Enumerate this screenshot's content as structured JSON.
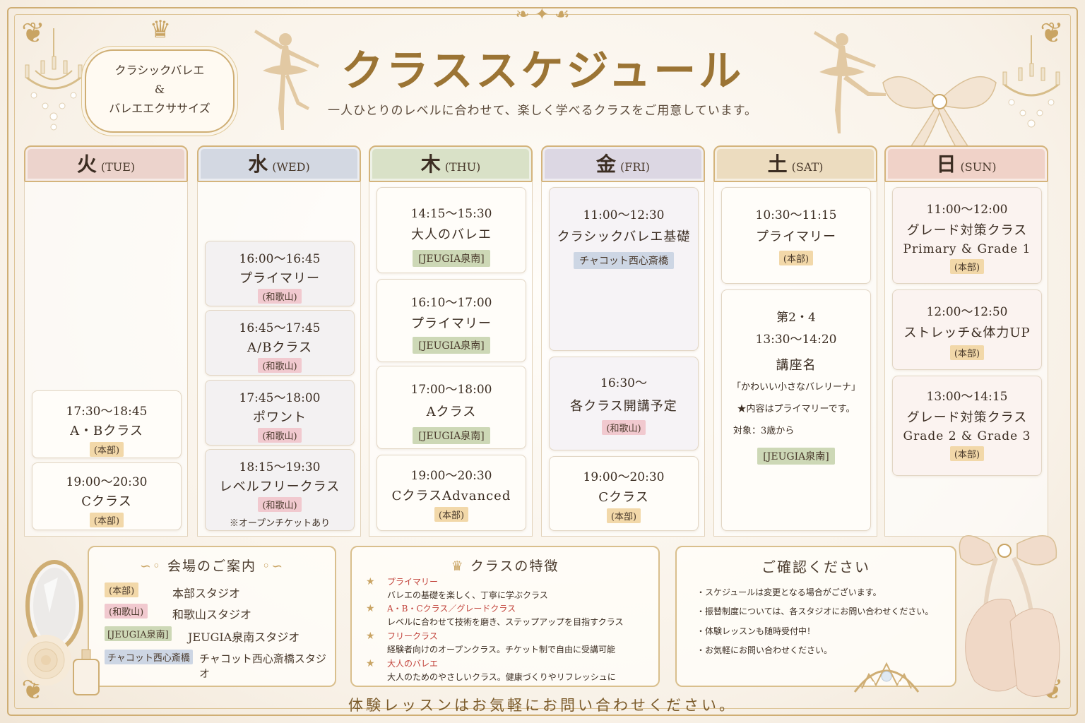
{
  "title": "クラススケジュール",
  "subtitle": "一人ひとりのレベルに合わせて、楽しく学べるクラスをご用意しています。",
  "plaque": {
    "line1": "クラシックバレエ",
    "line2": "&",
    "line3": "バレエエクササイズ"
  },
  "days": [
    {
      "day": "火",
      "en": "(TUE)",
      "classes": [
        {
          "time": "17:30〜18:45",
          "name": "A・Bクラス",
          "venue": "(本部)"
        },
        {
          "time": "19:00〜20:30",
          "name": "Cクラス",
          "venue": "(本部)"
        }
      ]
    },
    {
      "day": "水",
      "en": "(WED)",
      "classes": [
        {
          "time": "16:00〜16:45",
          "name": "プライマリー",
          "venue": "(和歌山)"
        },
        {
          "time": "16:45〜17:45",
          "name": "A/Bクラス",
          "venue": "(和歌山)"
        },
        {
          "time": "17:45〜18:00",
          "name": "ポワント",
          "venue": "(和歌山)"
        },
        {
          "time": "18:15〜19:30",
          "name": "レベルフリークラス",
          "venue": "(和歌山)",
          "note": "※オープンチケットあり"
        }
      ]
    },
    {
      "day": "木",
      "en": "(THU)",
      "classes": [
        {
          "time": "14:15〜15:30",
          "name": "大人のバレエ",
          "venue": "[JEUGIA泉南]"
        },
        {
          "time": "16:10〜17:00",
          "name": "プライマリー",
          "venue": "[JEUGIA泉南]"
        },
        {
          "time": "17:00〜18:00",
          "name": "Aクラス",
          "venue": "[JEUGIA泉南]"
        },
        {
          "time": "19:00〜20:30",
          "name": "CクラスAdvanced",
          "venue": "(本部)"
        }
      ]
    },
    {
      "day": "金",
      "en": "(FRI)",
      "classes": [
        {
          "time": "11:00〜12:30",
          "name": "クラシックバレエ基礎",
          "venue": "チャコット西心斎橋"
        },
        {
          "time": "16:30〜",
          "name": "各クラス開講予定",
          "venue": "(和歌山)"
        },
        {
          "time": "19:00〜20:30",
          "name": "Cクラス",
          "venue": "(本部)"
        }
      ]
    },
    {
      "day": "土",
      "en": "(SAT)",
      "classes": [
        {
          "time": "10:30〜11:15",
          "name": "プライマリー",
          "venue": "(本部)"
        },
        {
          "line1": "第2・4",
          "time": "13:30〜14:20",
          "name": "講座名",
          "subtitle": "「かわいい小さなバレリーナ」",
          "detail1": "★内容はプライマリーです。",
          "detail2": "対象：3歳から",
          "venue": "[JEUGIA泉南]"
        }
      ]
    },
    {
      "day": "日",
      "en": "(SUN)",
      "classes": [
        {
          "time": "11:00〜12:00",
          "name": "グレード対策クラス",
          "sub": "Primary & Grade 1",
          "venue": "(本部)"
        },
        {
          "time": "12:00〜12:50",
          "name": "ストレッチ&体力UP",
          "venue": "(本部)"
        },
        {
          "time": "13:00〜14:15",
          "name": "グレード対策クラス",
          "sub": "Grade 2 & Grade 3",
          "venue": "(本部)"
        }
      ]
    }
  ],
  "venues": {
    "title": "会場のご案内",
    "items": [
      {
        "tag": "(本部)",
        "name": "本部スタジオ"
      },
      {
        "tag": "(和歌山)",
        "name": "和歌山スタジオ"
      },
      {
        "tag": "[JEUGIA泉南]",
        "name": "JEUGIA泉南スタジオ"
      },
      {
        "tag": "チャコット西心斎橋",
        "name": "チャコット西心斎橋スタジオ"
      }
    ]
  },
  "features": {
    "title": "クラスの特徴",
    "items": [
      {
        "name": "プライマリー",
        "desc": "バレエの基礎を楽しく、丁寧に学ぶクラス"
      },
      {
        "name": "A・B・Cクラス／グレードクラス",
        "desc": "レベルに合わせて技術を磨き、ステップアップを目指すクラス"
      },
      {
        "name": "フリークラス",
        "desc": "経験者向けのオープンクラス。チケット制で自由に受講可能"
      },
      {
        "name": "大人のバレエ",
        "desc": "大人のためのやさしいクラス。健康づくりやリフレッシュに"
      }
    ]
  },
  "notice": {
    "title": "ご確認ください",
    "items": [
      "・スケジュールは変更となる場合がございます。",
      "・振替制度については、各スタジオにお問い合わせください。",
      "・体験レッスンも随時受付中！",
      "・お気軽にお問い合わせください。"
    ]
  },
  "footer": "体験レッスンはお気軽にお問い合わせください。",
  "colors": {
    "gold": "#c9a463",
    "title_gold": "#9b7434",
    "tue_head": "#ecd3cc",
    "wed_head": "#d3d8e2",
    "thu_head": "#d9e1c7",
    "fri_head": "#dcd7e3",
    "sat_head": "#ecdcbf",
    "sun_head": "#f0d2c8",
    "honbu_tag": "#f2d8a9",
    "wakayama_tag": "#f1c9cf",
    "jeugia_tag": "#cdd8b6",
    "chacott_tag": "#cdd6e4",
    "feature_name": "#c2443c"
  },
  "icons": [
    "crown-icon",
    "ballerina-icon",
    "bow-icon",
    "chandelier-icon",
    "star-icon",
    "mirror-icon",
    "rose-icon",
    "tiara-icon",
    "pointe-shoes-icon",
    "perfume-icon"
  ]
}
